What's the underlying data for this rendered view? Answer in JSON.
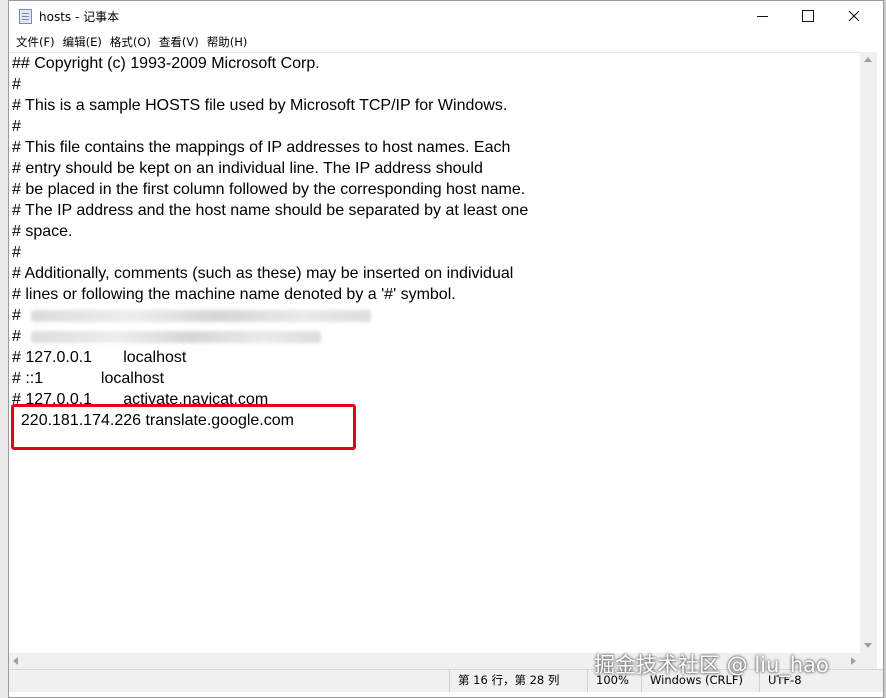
{
  "window": {
    "title": "hosts - 记事本",
    "icon": "notepad-icon"
  },
  "menu": [
    {
      "label": "文件(F)"
    },
    {
      "label": "编辑(E)"
    },
    {
      "label": "格式(O)"
    },
    {
      "label": "查看(V)"
    },
    {
      "label": "帮助(H)"
    }
  ],
  "editor": {
    "lines": [
      "## Copyright (c) 1993-2009 Microsoft Corp.",
      "#",
      "# This is a sample HOSTS file used by Microsoft TCP/IP for Windows.",
      "#",
      "# This file contains the mappings of IP addresses to host names. Each",
      "# entry should be kept on an individual line. The IP address should",
      "# be placed in the first column followed by the corresponding host name.",
      "# The IP address and the host name should be separated by at least one",
      "# space.",
      "#",
      "# Additionally, comments (such as these) may be inserted on individual",
      "# lines or following the machine name denoted by a '#' symbol.",
      "#",
      "#",
      "# 127.0.0.1       localhost",
      "# ::1             localhost",
      "# 127.0.0.1       activate.navicat.com",
      "  220.181.174.226 translate.google.com"
    ]
  },
  "status": {
    "position": "第 16 行，第 28 列",
    "zoom": "100%",
    "line_ending": "Windows (CRLF)",
    "encoding": "UTF-8"
  },
  "watermark": "掘金技术社区 @ liu_hao",
  "colors": {
    "highlight": "#e3001b"
  }
}
